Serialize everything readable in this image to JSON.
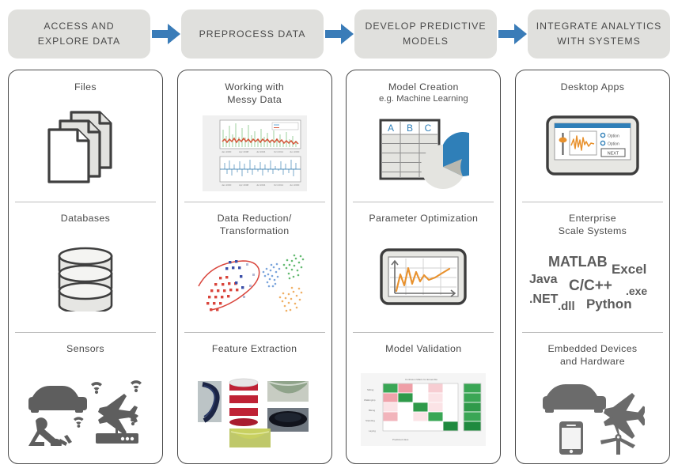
{
  "header": {
    "stages": [
      {
        "id": "access-explore-data",
        "lines": [
          "ACCESS AND",
          "EXPLORE DATA"
        ]
      },
      {
        "id": "preprocess-data",
        "lines": [
          "PREPROCESS DATA",
          ""
        ]
      },
      {
        "id": "develop-predictive-models",
        "lines": [
          "DEVELOP PREDICTIVE",
          "MODELS"
        ]
      },
      {
        "id": "integrate-analytics-with-systems",
        "lines": [
          "INTEGRATE ANALYTICS",
          "WITH SYSTEMS"
        ]
      }
    ]
  },
  "columns": [
    {
      "id": "access-explore-data",
      "cells": [
        {
          "id": "files",
          "title": "Files",
          "subtitle": "",
          "art": "stacked-documents-icon"
        },
        {
          "id": "databases",
          "title": "Databases",
          "subtitle": "",
          "art": "database-cylinder-icon"
        },
        {
          "id": "sensors",
          "title": "Sensors",
          "subtitle": "",
          "art": "sensor-devices-icon"
        }
      ]
    },
    {
      "id": "preprocess-data",
      "cells": [
        {
          "id": "working-with-messy-data",
          "title": "Working with\nMessy Data",
          "subtitle": "",
          "art": "timeseries-plots-thumbnail"
        },
        {
          "id": "data-reduction-transformation",
          "title": "Data Reduction/\nTransformation",
          "subtitle": "",
          "art": "scatter-clusters-thumbnail"
        },
        {
          "id": "feature-extraction",
          "title": "Feature Extraction",
          "subtitle": "",
          "art": "mug-photos-thumbnail"
        }
      ]
    },
    {
      "id": "develop-predictive-models",
      "cells": [
        {
          "id": "model-creation",
          "title": "Model Creation",
          "subtitle": "e.g. Machine Learning",
          "art": "table-pie-icon"
        },
        {
          "id": "parameter-optimization",
          "title": "Parameter Optimization",
          "subtitle": "",
          "art": "monitor-linechart-icon"
        },
        {
          "id": "model-validation",
          "title": "Model Validation",
          "subtitle": "",
          "art": "confusion-matrix-thumbnail"
        }
      ]
    },
    {
      "id": "integrate-analytics-with-systems",
      "cells": [
        {
          "id": "desktop-apps",
          "title": "Desktop Apps",
          "subtitle": "",
          "art": "app-window-icon"
        },
        {
          "id": "enterprise-scale-systems",
          "title": "Enterprise\nScale Systems",
          "subtitle": "",
          "art": "language-wordcloud"
        },
        {
          "id": "embedded-devices",
          "title": "Embedded Devices\nand Hardware",
          "subtitle": "",
          "art": "embedded-hardware-icon"
        }
      ]
    }
  ],
  "wordcloud": {
    "matlab": "MATLAB",
    "excel": "Excel",
    "java": "Java",
    "cpp": "C/C++",
    "exe": ".exe",
    "net": ".NET",
    "dll": ".dll",
    "python": "Python"
  },
  "app_window": {
    "option1": "Option",
    "option2": "Option",
    "next_label": "NEXT"
  },
  "model_table": {
    "headers": [
      "A",
      "B",
      "C"
    ],
    "body_rows": 5
  },
  "confusion_matrix": {
    "xlabel": "Predicted class",
    "rows": 5,
    "cols": 5
  },
  "colors": {
    "stage_box": "#e0e0dd",
    "arrow_blue": "#3a7cb8",
    "card_border": "#4a4a4a",
    "divider": "#bcbcbc",
    "text": "#4a4a4a",
    "accent_orange": "#e8912d",
    "accent_blue": "#2f7fb8",
    "icon_gray": "#6b6b6b",
    "heat_green": "#2ea44f",
    "heat_pink": "#f2c9cd"
  }
}
